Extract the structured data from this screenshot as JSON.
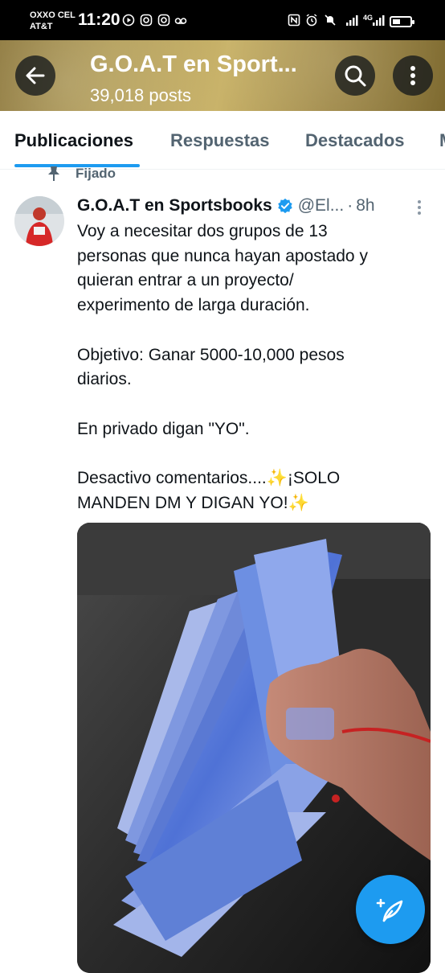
{
  "status_bar": {
    "carrier_line1": "OXXO CEL",
    "carrier_line2": "AT&T",
    "time": "11:20",
    "network": "4G"
  },
  "header": {
    "title": "G.O.A.T en Sport...",
    "post_count": "39,018 posts"
  },
  "tabs": [
    {
      "label": "Publicaciones",
      "active": true
    },
    {
      "label": "Respuestas",
      "active": false
    },
    {
      "label": "Destacados",
      "active": false
    }
  ],
  "tweet": {
    "pinned_label": "Fijado",
    "author": "G.O.A.T en Sportsbooks",
    "handle": "@El...",
    "separator": "·",
    "time": "8h",
    "lines": [
      "Voy a necesitar dos grupos de 13",
      "personas que nunca hayan apostado y",
      "quieran entrar a un proyecto/",
      "experimento de larga duración.",
      "",
      "Objetivo: Ganar 5000-10,000 pesos",
      "diarios.",
      "",
      "En privado digan \"YO\".",
      "",
      "Desactivo comentarios....✨¡SOLO",
      "MANDEN DM Y DIGAN YO!✨"
    ]
  },
  "colors": {
    "accent": "#1d9bf0",
    "text_primary": "#0f1419",
    "text_secondary": "#536471",
    "header_banner": "#b09a52"
  },
  "icons": {
    "back": "arrow-left-icon",
    "search": "search-icon",
    "more": "more-vertical-icon",
    "pin": "pin-icon",
    "verified": "verified-badge-icon",
    "compose": "compose-feather-icon"
  }
}
